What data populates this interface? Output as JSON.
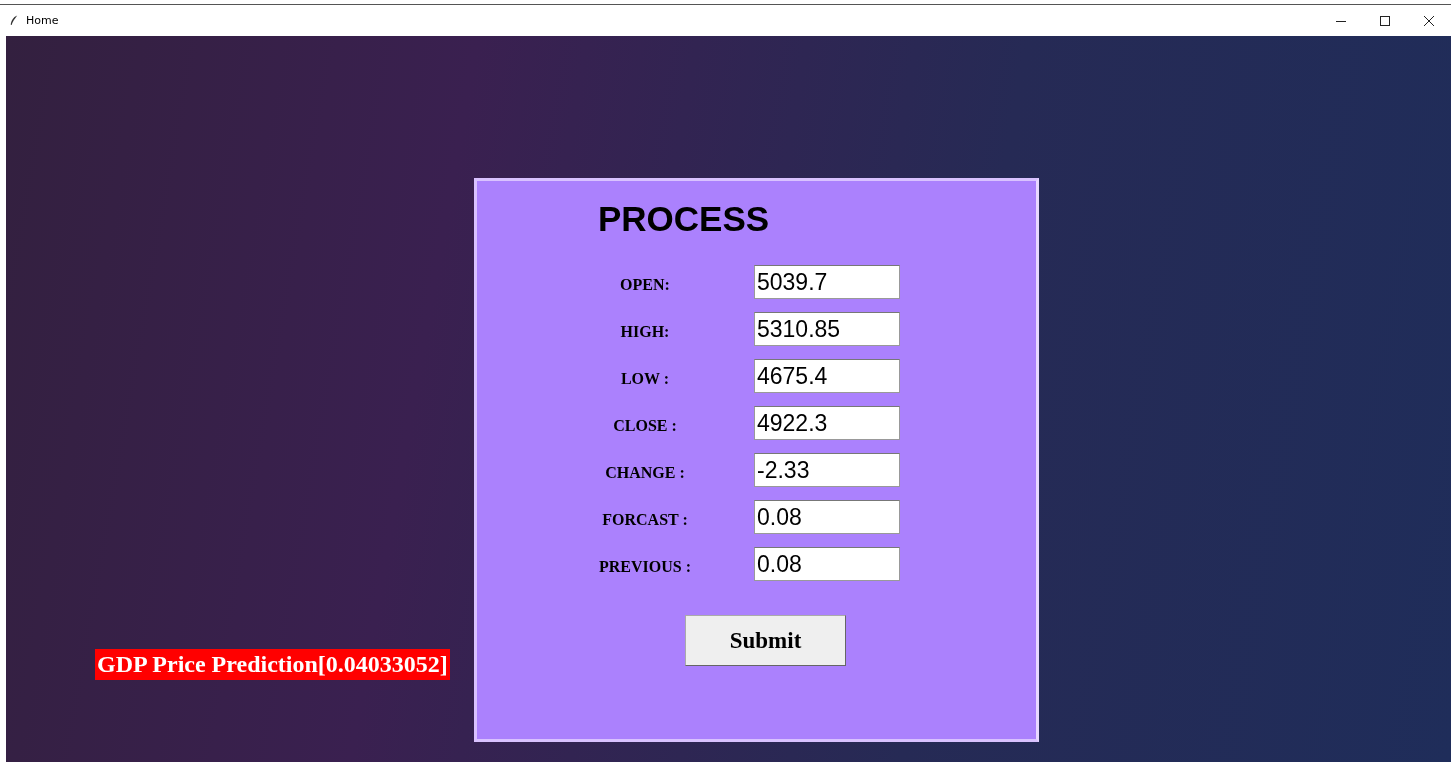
{
  "window": {
    "title": "Home"
  },
  "form": {
    "title": "PROCESS",
    "fields": [
      {
        "label": "OPEN:",
        "value": "5039.7"
      },
      {
        "label": "HIGH:",
        "value": "5310.85"
      },
      {
        "label": "LOW :",
        "value": "4675.4"
      },
      {
        "label": "CLOSE :",
        "value": "4922.3"
      },
      {
        "label": "CHANGE :",
        "value": "-2.33"
      },
      {
        "label": "FORCAST :",
        "value": "0.08"
      },
      {
        "label": "PREVIOUS :",
        "value": "0.08"
      }
    ],
    "submit": "Submit"
  },
  "result": "GDP Price Prediction[0.04033052]"
}
